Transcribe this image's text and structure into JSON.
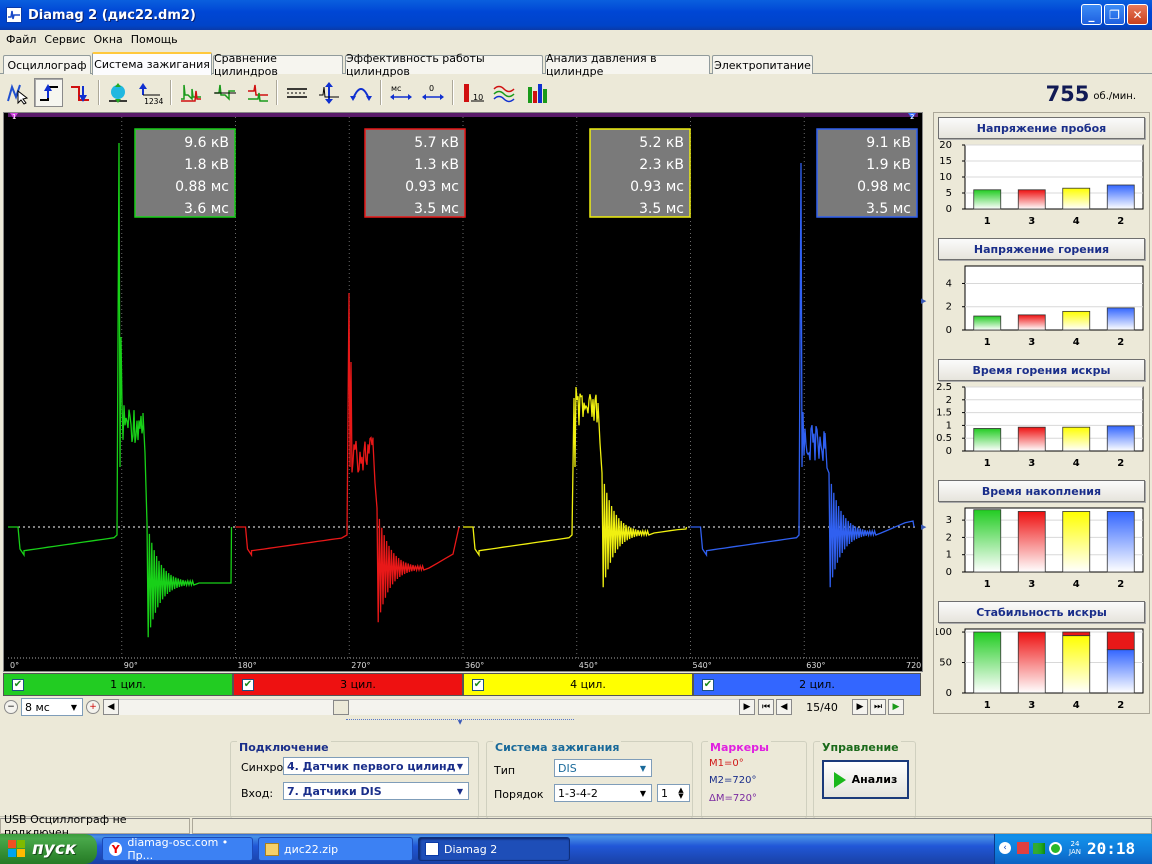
{
  "window": {
    "title": "Diamag 2 (дис22.dm2)",
    "min": "_",
    "max": "❐",
    "close": "✕"
  },
  "menu": [
    "Файл",
    "Сервис",
    "Окна",
    "Помощь"
  ],
  "tabs": [
    "Осциллограф",
    "Система зажигания",
    "Сравнение цилиндров",
    "Эффективность работы цилиндров",
    "Анализ давления в цилиндре",
    "Электропитание"
  ],
  "active_tab": 1,
  "rpm": {
    "value": "755",
    "unit": "об./мин."
  },
  "colors": {
    "cyl1": "#18d018",
    "cyl3": "#e81818",
    "cyl4": "#f0f010",
    "cyl2": "#3060f0",
    "bg": "#000000"
  },
  "scope": {
    "markers": [
      "1",
      "2"
    ],
    "x_ticks": [
      "0°",
      "90°",
      "180°",
      "270°",
      "360°",
      "450°",
      "540°",
      "630°",
      "720°"
    ],
    "readings": [
      {
        "cyl": "1",
        "color": "cyl1",
        "vals": [
          "9.6 кВ",
          "1.8 кВ",
          "0.88 мс",
          "3.6 мс"
        ]
      },
      {
        "cyl": "3",
        "color": "cyl3",
        "vals": [
          "5.7 кВ",
          "1.3 кВ",
          "0.93 мс",
          "3.5 мс"
        ]
      },
      {
        "cyl": "4",
        "color": "cyl4",
        "vals": [
          "5.2 кВ",
          "2.3 кВ",
          "0.93 мс",
          "3.5 мс"
        ]
      },
      {
        "cyl": "2",
        "color": "cyl2",
        "vals": [
          "9.1 кВ",
          "1.9 кВ",
          "0.98 мс",
          "3.5 мс"
        ]
      }
    ]
  },
  "channels": [
    {
      "label": "1 цил.",
      "color": "#22cc22"
    },
    {
      "label": "3 цил.",
      "color": "#ee1111"
    },
    {
      "label": "4 цил.",
      "color": "#ffff00"
    },
    {
      "label": "2 цил.",
      "color": "#3366ff"
    }
  ],
  "controls": {
    "timebase": "8 мс",
    "frame": "15/40"
  },
  "charts": [
    {
      "title": "Напряжение пробоя",
      "yticks": [
        "20",
        "15",
        "10",
        "5",
        "0"
      ],
      "ymax": 20,
      "cats": [
        "1",
        "3",
        "4",
        "2"
      ],
      "values": [
        6,
        6,
        6.5,
        7.5
      ]
    },
    {
      "title": "Напряжение горения",
      "yticks": [
        "4",
        "2",
        "0"
      ],
      "ymax": 5.5,
      "cats": [
        "1",
        "3",
        "4",
        "2"
      ],
      "values": [
        1.2,
        1.3,
        1.6,
        1.9
      ]
    },
    {
      "title": "Время горения искры",
      "yticks": [
        "2.5",
        "2",
        "1.5",
        "1",
        "0.5",
        "0"
      ],
      "ymax": 2.5,
      "cats": [
        "1",
        "3",
        "4",
        "2"
      ],
      "values": [
        0.88,
        0.93,
        0.93,
        0.98
      ]
    },
    {
      "title": "Время накопления",
      "yticks": [
        "3",
        "2",
        "1",
        "0"
      ],
      "ymax": 3.7,
      "cats": [
        "1",
        "3",
        "4",
        "2"
      ],
      "values": [
        3.6,
        3.5,
        3.5,
        3.5
      ]
    },
    {
      "title": "Стабильность искры",
      "yticks": [
        "100",
        "50",
        "0"
      ],
      "ymax": 105,
      "cats": [
        "1",
        "3",
        "4",
        "2"
      ],
      "values": [
        100,
        100,
        94,
        71
      ],
      "red": [
        0,
        0,
        6,
        29
      ]
    }
  ],
  "chart_data": [
    {
      "type": "bar",
      "title": "Напряжение пробоя",
      "categories": [
        "1",
        "3",
        "4",
        "2"
      ],
      "values": [
        6,
        6,
        6.5,
        7.5
      ],
      "ylim": [
        0,
        20
      ]
    },
    {
      "type": "bar",
      "title": "Напряжение горения",
      "categories": [
        "1",
        "3",
        "4",
        "2"
      ],
      "values": [
        1.2,
        1.3,
        1.6,
        1.9
      ],
      "ylim": [
        0,
        5.5
      ]
    },
    {
      "type": "bar",
      "title": "Время горения искры",
      "categories": [
        "1",
        "3",
        "4",
        "2"
      ],
      "values": [
        0.88,
        0.93,
        0.93,
        0.98
      ],
      "ylim": [
        0,
        2.5
      ]
    },
    {
      "type": "bar",
      "title": "Время накопления",
      "categories": [
        "1",
        "3",
        "4",
        "2"
      ],
      "values": [
        3.6,
        3.5,
        3.5,
        3.5
      ],
      "ylim": [
        0,
        3.7
      ]
    },
    {
      "type": "bar",
      "title": "Стабильность искры",
      "categories": [
        "1",
        "3",
        "4",
        "2"
      ],
      "series": [
        {
          "values": [
            100,
            100,
            94,
            71
          ]
        },
        {
          "values": [
            0,
            0,
            6,
            29
          ]
        }
      ],
      "ylim": [
        0,
        105
      ]
    }
  ],
  "connection": {
    "title": "Подключение",
    "sync_label": "Синхро:",
    "sync_value": "4.  Датчик первого цилинд",
    "input_label": "Вход:",
    "input_value": "7.  Датчики DIS"
  },
  "ignition": {
    "title": "Система зажигания",
    "type_label": "Тип",
    "type_value": "DIS",
    "order_label": "Порядок",
    "order_value": "1-3-4-2",
    "order_num": "1"
  },
  "markers": {
    "title": "Маркеры",
    "m1": "M1=0°",
    "m2": "M2=720°",
    "dm": "ΔM=720°"
  },
  "control": {
    "title": "Управление",
    "button": "Анализ"
  },
  "status": {
    "text": "USB Осциллограф не подключен"
  },
  "taskbar": {
    "start": "пуск",
    "tasks": [
      "diamag-osc.com • Пр...",
      "дис22.zip",
      "Diamag 2"
    ],
    "clock": "20:18",
    "date_day": "24",
    "date_mon": "JAN"
  }
}
